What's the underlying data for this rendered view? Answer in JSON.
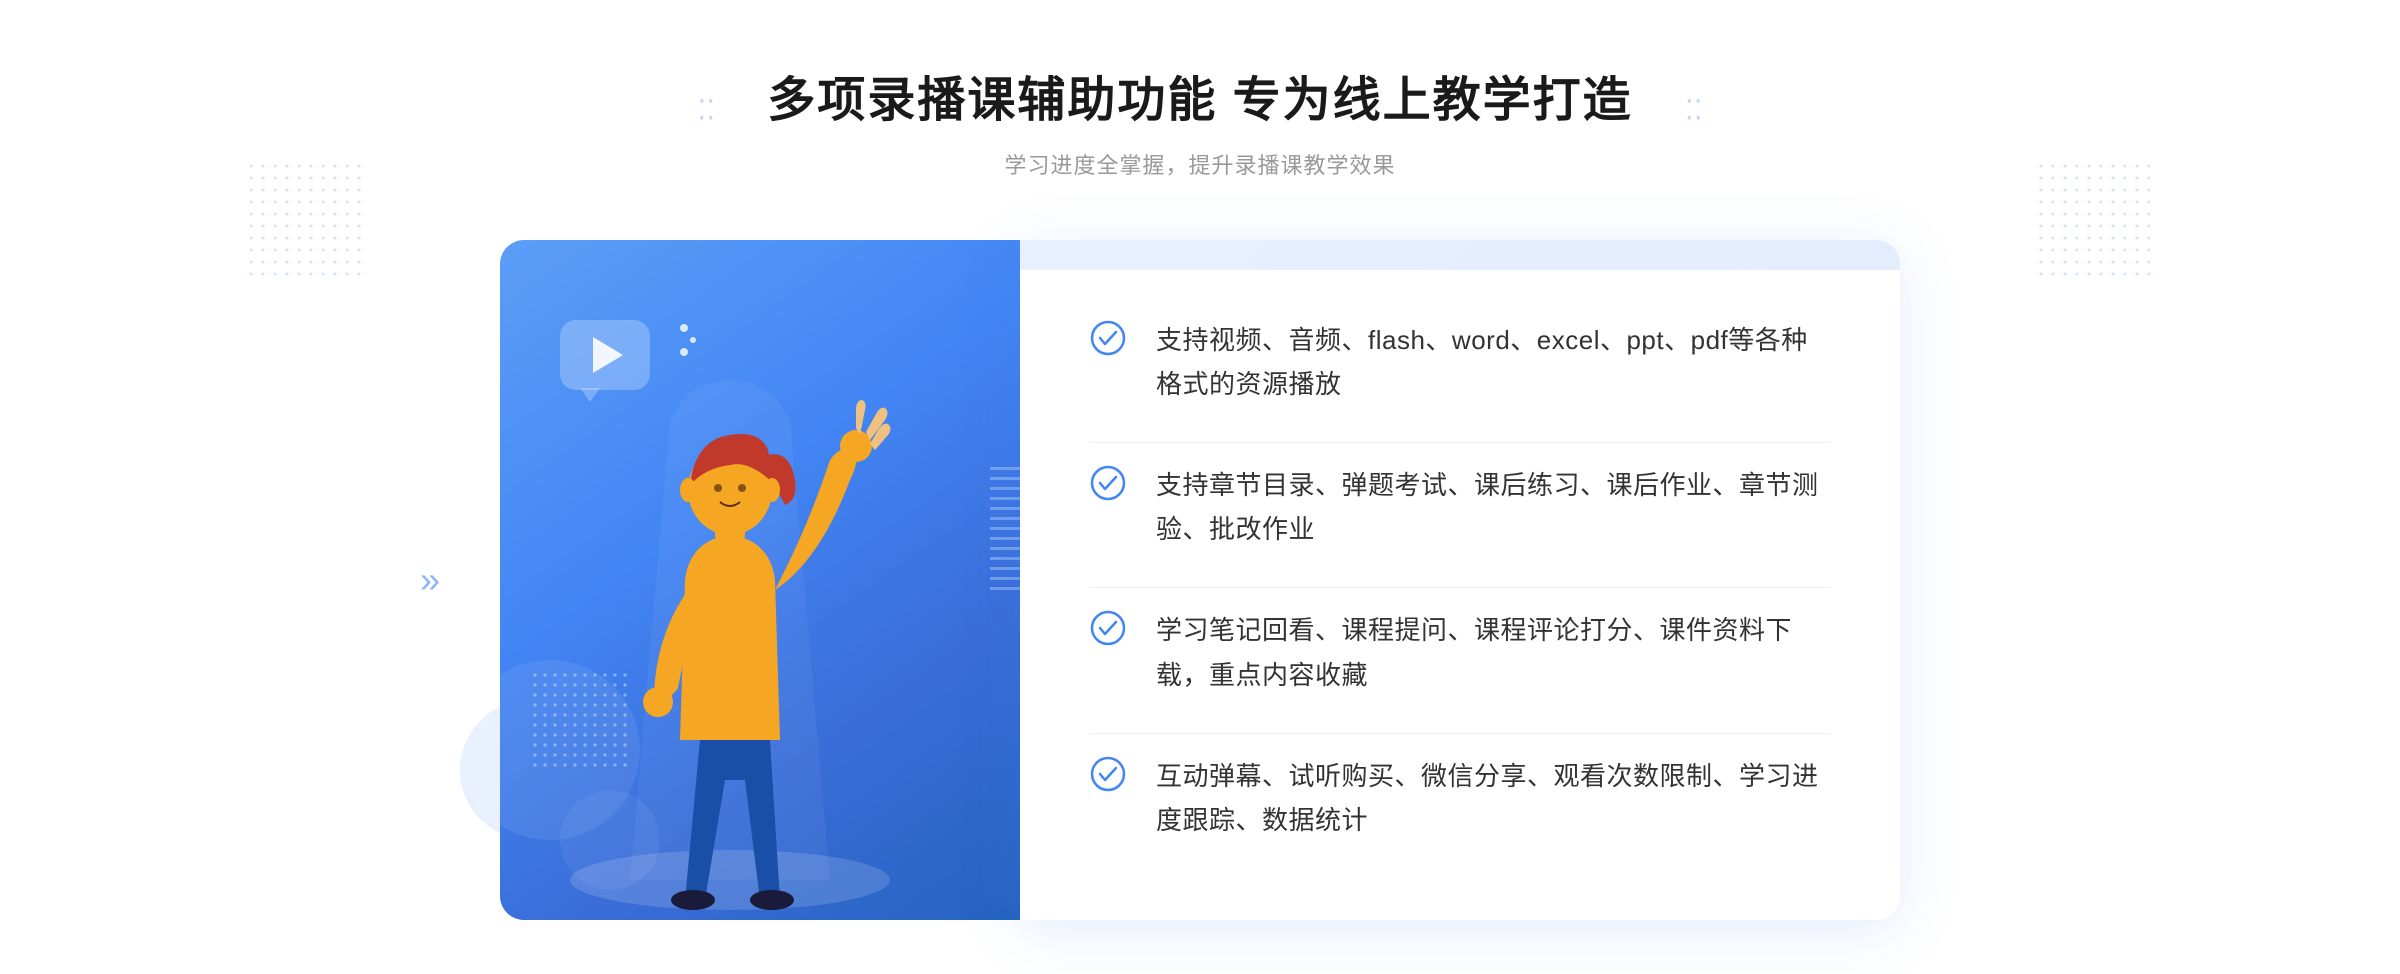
{
  "header": {
    "main_title": "多项录播课辅助功能 专为线上教学打造",
    "sub_title": "学习进度全掌握，提升录播课教学效果"
  },
  "features": [
    {
      "id": "feature-1",
      "text": "支持视频、音频、flash、word、excel、ppt、pdf等各种格式的资源播放"
    },
    {
      "id": "feature-2",
      "text": "支持章节目录、弹题考试、课后练习、课后作业、章节测验、批改作业"
    },
    {
      "id": "feature-3",
      "text": "学习笔记回看、课程提问、课程评论打分、课件资料下载，重点内容收藏"
    },
    {
      "id": "feature-4",
      "text": "互动弹幕、试听购买、微信分享、观看次数限制、学习进度跟踪、数据统计"
    }
  ],
  "colors": {
    "primary": "#4285f4",
    "check_color": "#4285f4",
    "title_color": "#1a1a1a",
    "text_color": "#333333",
    "sub_color": "#999999"
  },
  "icons": {
    "check": "check-circle-icon",
    "play": "play-icon",
    "chevron": "chevron-right-icon"
  }
}
